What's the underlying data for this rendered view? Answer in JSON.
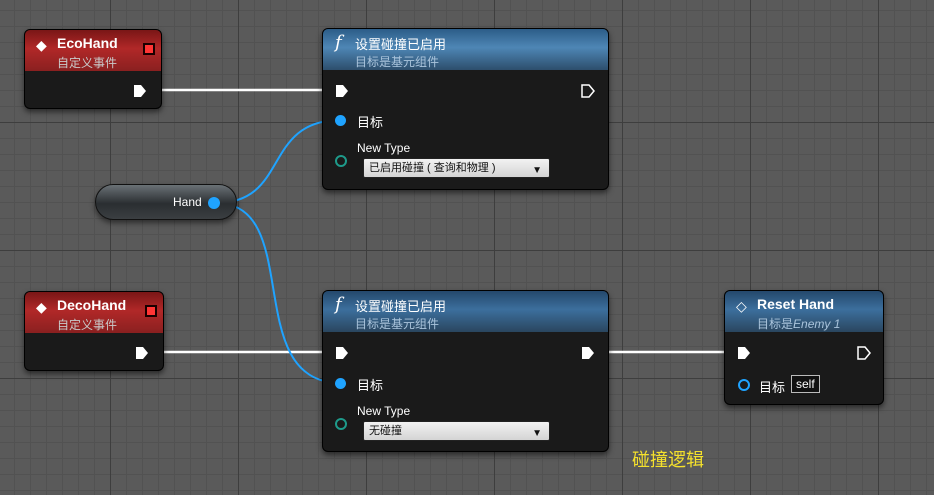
{
  "colors": {
    "event_header": "#b12828",
    "function_header": "#4e86b5",
    "object_pin": "#1fa3ff",
    "comment_text": "#f5e12c"
  },
  "nodes": {
    "event_eco": {
      "title": "EcoHand",
      "subtitle": "自定义事件"
    },
    "event_deco": {
      "title": "DecoHand",
      "subtitle": "自定义事件"
    },
    "set_collision_1": {
      "title": "设置碰撞已启用",
      "subtitle": "目标是基元组件",
      "target_label": "目标",
      "new_type_label": "New Type",
      "new_type_value": "已启用碰撞 ( 查询和物理 )"
    },
    "set_collision_2": {
      "title": "设置碰撞已启用",
      "subtitle": "目标是基元组件",
      "target_label": "目标",
      "new_type_label": "New Type",
      "new_type_value": "无碰撞"
    },
    "reset_hand": {
      "title": "Reset Hand",
      "subtitle_prefix": "目标是",
      "subtitle_class": "Enemy 1",
      "target_label": "目标",
      "target_value": "self"
    },
    "hand_var": {
      "label": "Hand"
    }
  },
  "comment": {
    "text": "碰撞逻辑"
  }
}
